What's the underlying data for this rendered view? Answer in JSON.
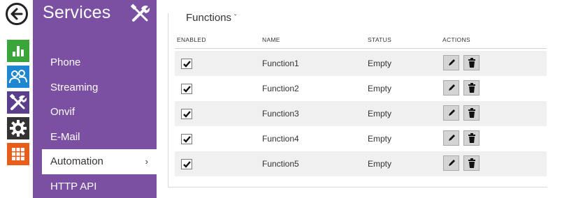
{
  "sidebar": {
    "title": "Services",
    "items": [
      {
        "label": "Phone"
      },
      {
        "label": "Streaming"
      },
      {
        "label": "Onvif"
      },
      {
        "label": "E-Mail"
      },
      {
        "label": "Automation",
        "chevron": "›"
      },
      {
        "label": "HTTP API"
      }
    ],
    "active_index": 4,
    "background_color": "#7b4fa2"
  },
  "rail": {
    "icons": [
      "back-arrow-icon",
      "bar-chart-icon",
      "users-icon",
      "tools-icon",
      "gear-icon",
      "grid-icon"
    ],
    "colors": [
      "#3aa63a",
      "#1f86d1",
      "#5b3f8c",
      "#333333",
      "#e85d1a"
    ]
  },
  "content": {
    "title": "Functions",
    "caret": "ˇ",
    "columns": {
      "enabled": "ENABLED",
      "name": "NAME",
      "status": "STATUS",
      "actions": "ACTIONS"
    },
    "rows": [
      {
        "enabled": true,
        "name": "Function1",
        "status": "Empty"
      },
      {
        "enabled": true,
        "name": "Function2",
        "status": "Empty"
      },
      {
        "enabled": true,
        "name": "Function3",
        "status": "Empty"
      },
      {
        "enabled": true,
        "name": "Function4",
        "status": "Empty"
      },
      {
        "enabled": true,
        "name": "Function5",
        "status": "Empty"
      }
    ]
  }
}
